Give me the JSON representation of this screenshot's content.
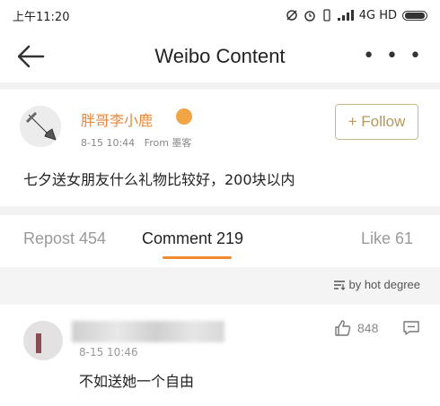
{
  "status_bar": {
    "time": "上午11:20",
    "network": "4G HD"
  },
  "nav": {
    "title": "Weibo Content",
    "back_icon": "back-arrow-icon",
    "more_label": "• • •"
  },
  "post": {
    "username": "胖哥李小鹿",
    "time": "8-15 10:44",
    "source": "From 墨客",
    "follow_label": "+ Follow",
    "text": "七夕送女朋友什么礼物比较好，200块以内"
  },
  "tabs": [
    {
      "label": "Repost 454"
    },
    {
      "label": "Comment 219"
    },
    {
      "label": "Like 61"
    }
  ],
  "sort": {
    "label": "by hot degree",
    "icon": "sort-icon"
  },
  "comment": {
    "time": "8-15 10:46",
    "text": "不如送她一个自由",
    "like_count": "848"
  },
  "colors": {
    "accent": "#f08a2a",
    "username": "#e8873a",
    "follow": "#b49a5c"
  }
}
